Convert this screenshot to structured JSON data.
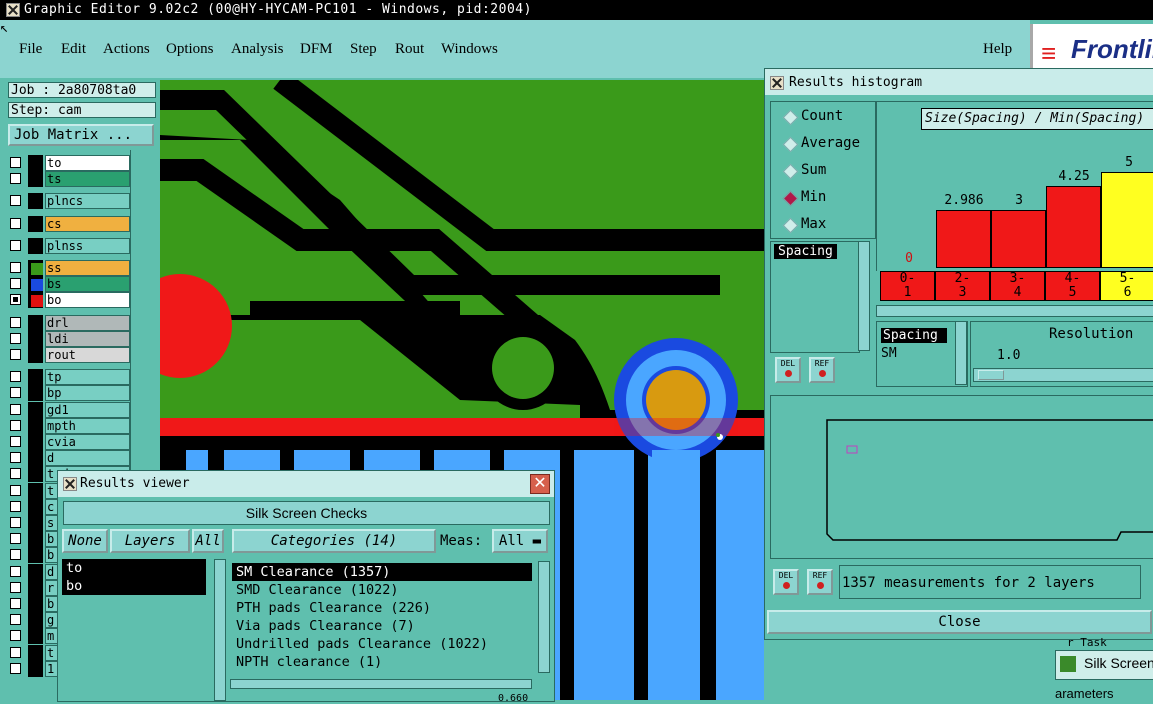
{
  "window": {
    "title": "Graphic Editor 9.02c2 (00@HY-HYCAM-PC101 - Windows, pid:2004)"
  },
  "menu": {
    "items": [
      "File",
      "Edit",
      "Actions",
      "Options",
      "Analysis",
      "DFM",
      "Step",
      "Rout",
      "Windows"
    ],
    "help": "Help"
  },
  "logo": {
    "mark": "≡",
    "text": "Frontline"
  },
  "job": {
    "job_label": "Job : 2a80708ta0",
    "step_label": "Step: cam",
    "matrix_button": "Job Matrix ..."
  },
  "layers": [
    {
      "name": "to",
      "swatch": "#000000",
      "fill": "#ffffff",
      "checked": false
    },
    {
      "name": "ts",
      "swatch": "#000000",
      "fill": "#2aa070",
      "checked": false
    },
    {
      "name": "plncs",
      "swatch": "#000000",
      "fill": "#78cfc3",
      "checked": false
    },
    {
      "name": "cs",
      "swatch": "#000000",
      "fill": "#f0b040",
      "checked": false
    },
    {
      "name": "plnss",
      "swatch": "#000000",
      "fill": "#78cfc3",
      "checked": false
    },
    {
      "name": "ss",
      "swatch": "#3a9a1a",
      "fill": "#f0b040",
      "checked": false
    },
    {
      "name": "bs",
      "swatch": "#1a4ae0",
      "fill": "#2aa070",
      "checked": false
    },
    {
      "name": "bo",
      "swatch": "#e01010",
      "fill": "#ffffff",
      "checked": true
    },
    {
      "name": "drl",
      "swatch": "#000000",
      "fill": "#b0b8b8",
      "checked": false
    },
    {
      "name": "ldi",
      "swatch": "#000000",
      "fill": "#b0b8b8",
      "checked": false
    },
    {
      "name": "rout",
      "swatch": "#000000",
      "fill": "#d8d8d8",
      "checked": false
    },
    {
      "name": "tp",
      "swatch": "#000000",
      "fill": "#78cfc3",
      "checked": false
    },
    {
      "name": "bp",
      "swatch": "#000000",
      "fill": "#78cfc3",
      "checked": false
    },
    {
      "name": "gd1",
      "swatch": "#000000",
      "fill": "#78cfc3",
      "checked": false
    },
    {
      "name": "mpth",
      "swatch": "#000000",
      "fill": "#78cfc3",
      "checked": false
    },
    {
      "name": "cvia",
      "swatch": "#000000",
      "fill": "#78cfc3",
      "checked": false
    },
    {
      "name": "d",
      "swatch": "#000000",
      "fill": "#78cfc3",
      "checked": false
    },
    {
      "name": "t d",
      "swatch": "#000000",
      "fill": "#78cfc3",
      "checked": false
    },
    {
      "name": "t",
      "swatch": "#000000",
      "fill": "#78cfc3",
      "checked": false
    },
    {
      "name": "c",
      "swatch": "#000000",
      "fill": "#78cfc3",
      "checked": false
    },
    {
      "name": "s",
      "swatch": "#000000",
      "fill": "#78cfc3",
      "checked": false
    },
    {
      "name": "b",
      "swatch": "#000000",
      "fill": "#78cfc3",
      "checked": false
    },
    {
      "name": "b",
      "swatch": "#000000",
      "fill": "#78cfc3",
      "checked": false
    },
    {
      "name": "d",
      "swatch": "#000000",
      "fill": "#78cfc3",
      "checked": false
    },
    {
      "name": "r",
      "swatch": "#000000",
      "fill": "#78cfc3",
      "checked": false
    },
    {
      "name": "b",
      "swatch": "#000000",
      "fill": "#78cfc3",
      "checked": false
    },
    {
      "name": "g",
      "swatch": "#000000",
      "fill": "#78cfc3",
      "checked": false
    },
    {
      "name": "m",
      "swatch": "#000000",
      "fill": "#78cfc3",
      "checked": false
    },
    {
      "name": "t",
      "swatch": "#000000",
      "fill": "#78cfc3",
      "checked": false
    },
    {
      "name": "1",
      "swatch": "#000000",
      "fill": "#78cfc3",
      "checked": false
    }
  ],
  "results_viewer": {
    "title": "Results viewer",
    "heading": "Silk Screen Checks",
    "none_button": "None",
    "layers_button": "Layers",
    "all_button": "All",
    "categories_button": "Categories (14)",
    "meas_label": "Meas:",
    "meas_value": "All",
    "layer_list": [
      "to",
      "bo"
    ],
    "categories": [
      "SM Clearance (1357)",
      "SMD Clearance (1022)",
      "PTH pads Clearance (226)",
      "Via pads Clearance (7)",
      "Undrilled pads Clearance (1022)",
      "NPTH clearance (1)"
    ],
    "bottom_value": "0.660"
  },
  "results_histogram": {
    "title": "Results histogram",
    "modes": [
      {
        "label": "Count",
        "selected": false
      },
      {
        "label": "Average",
        "selected": false
      },
      {
        "label": "Sum",
        "selected": false
      },
      {
        "label": "Min",
        "selected": true
      },
      {
        "label": "Max",
        "selected": false
      }
    ],
    "field_list": [
      "Spacing"
    ],
    "chart_title": "Size(Spacing) / Min(Spacing)",
    "spacing_label": "Spacing",
    "sm_label": "SM",
    "resolution_label": "Resolution",
    "resolution_value": "1.0",
    "status": "1357 measurements for 2 layers",
    "close_button": "Close",
    "del_label": "DEL",
    "ref_label": "REF"
  },
  "chart_data": {
    "type": "bar",
    "title": "Size(Spacing) / Min(Spacing)",
    "categories": [
      "0-1",
      "2-3",
      "3-4",
      "4-5",
      "5-6"
    ],
    "values": [
      0,
      2.986,
      3,
      4.25,
      5
    ],
    "value_labels": [
      "0",
      "2.986",
      "3",
      "4.25",
      "5"
    ],
    "colors": [
      "#f01818",
      "#f01818",
      "#f01818",
      "#f01818",
      "#ffff20"
    ],
    "ylim": [
      0,
      5.6
    ]
  },
  "bottom_right": {
    "tab_text": "Silk Screen",
    "partial_text": "arameters",
    "partial_top": "r Task"
  },
  "colors": {
    "panel": "#5fbfae",
    "menubar": "#8cd4d0",
    "pcb_green": "#3a9a1a",
    "pcb_red": "#f01818",
    "pad_blue": "#4aa6ff",
    "ring_blue": "#1a4ae0"
  }
}
